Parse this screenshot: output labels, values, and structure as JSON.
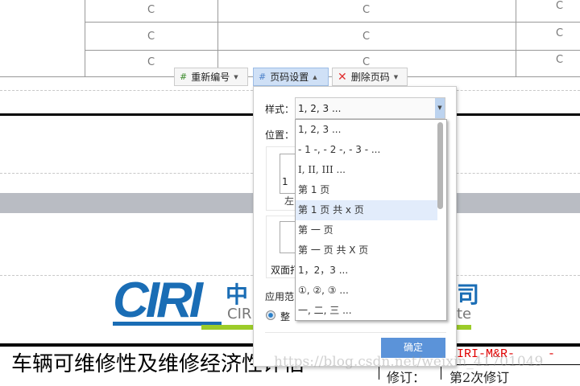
{
  "table": {
    "cells": [
      "C",
      "C",
      "C",
      "C",
      "C",
      "C",
      "C",
      "C",
      "C"
    ]
  },
  "toolbar": {
    "renumber": "重新编号",
    "page_setup": "页码设置",
    "delete": "删除页码"
  },
  "dialog": {
    "style_label": "样式：",
    "style_value": "1, 2, 3 ...",
    "position_label": "位置：",
    "preview_num": "1",
    "left_label": "左",
    "duplex_label": "双面打",
    "apply_label": "应用范",
    "apply_option": "整",
    "ok": "确定",
    "options": [
      "1, 2, 3 ...",
      "- 1 -, - 2 -, - 3 - ...",
      "I, II, III ...",
      "第 1 页",
      "第 1 页 共 x 页",
      "第 一 页",
      "第 一 页 共 X 页",
      "1，2，3 ...",
      "①, ②, ③ ...",
      "一, 二, 三 ..."
    ],
    "highlighted_index": 4
  },
  "doc": {
    "logo": "CIRI",
    "logo_cn": "中",
    "logo_en": "CIR",
    "logo_tail_cn": "司",
    "logo_tail_en": "te",
    "title": "车辆可维修性及维修经济性评估",
    "code": "IRI-M&R-",
    "code_dash": "-",
    "rev_label": "修订：",
    "rev_value": "第2次修订",
    "watermark": "https://blog.csdn.net/weixin_41701049"
  },
  "colors": {
    "accent": "#5b93d9",
    "logo_blue": "#1a6db5",
    "logo_green": "#9ccc29",
    "red": "#e00000"
  }
}
